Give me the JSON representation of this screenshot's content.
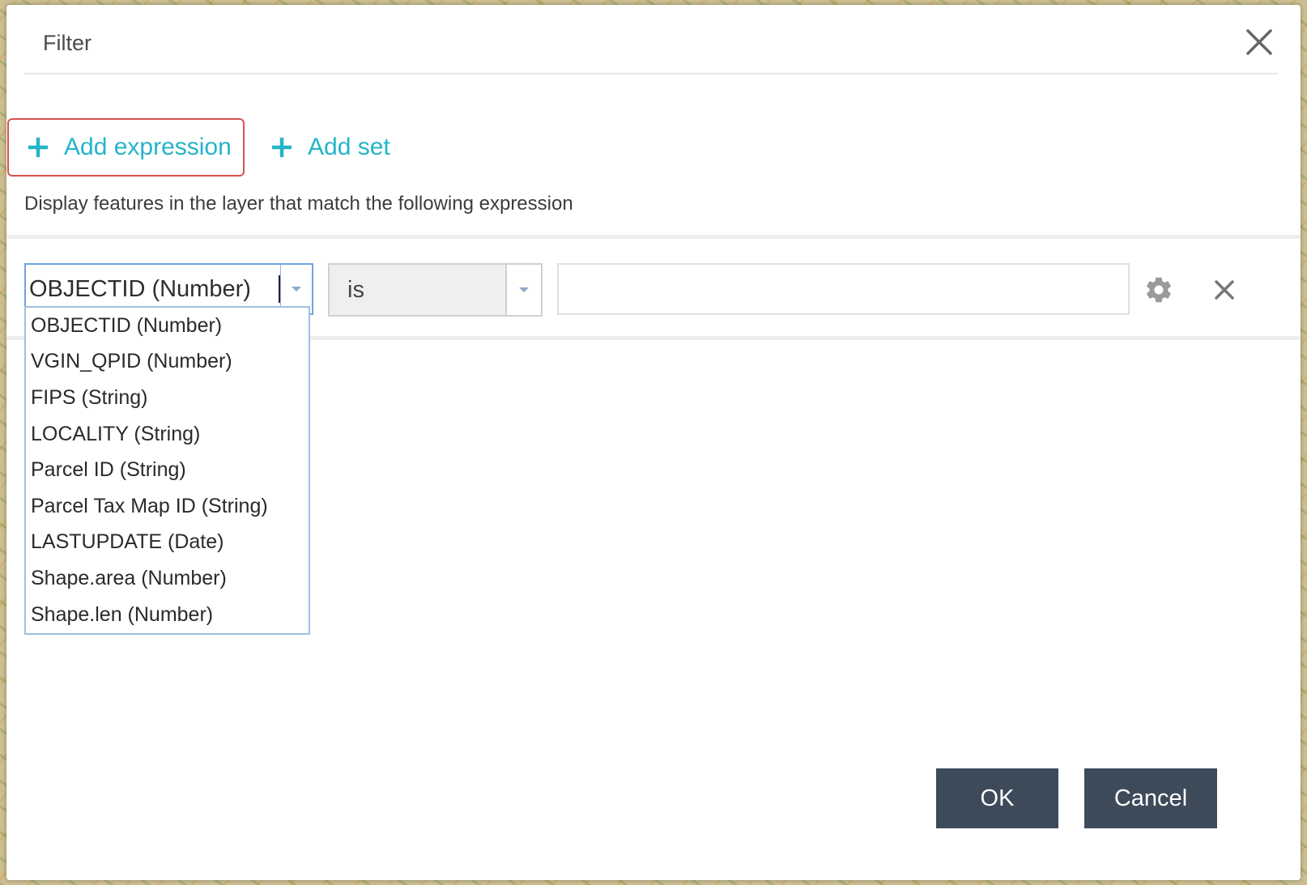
{
  "dialog": {
    "title": "Filter",
    "add_expression_label": "Add expression",
    "add_set_label": "Add set",
    "description": "Display features in the layer that match the following expression",
    "ok_label": "OK",
    "cancel_label": "Cancel"
  },
  "expression": {
    "field_value": "OBJECTID (Number)",
    "operator_value": "is",
    "input_value": ""
  },
  "field_options": [
    "OBJECTID (Number)",
    "VGIN_QPID (Number)",
    "FIPS (String)",
    "LOCALITY (String)",
    "Parcel ID (String)",
    "Parcel Tax Map ID (String)",
    "LASTUPDATE (Date)",
    "Shape.area (Number)",
    "Shape.len (Number)"
  ],
  "colors": {
    "accent": "#24b5c8",
    "highlight_border": "#d9534f",
    "button_bg": "#3d4a5a"
  },
  "icons": [
    "close-icon",
    "plus-icon",
    "chevron-down-icon",
    "gear-icon",
    "remove-icon"
  ]
}
